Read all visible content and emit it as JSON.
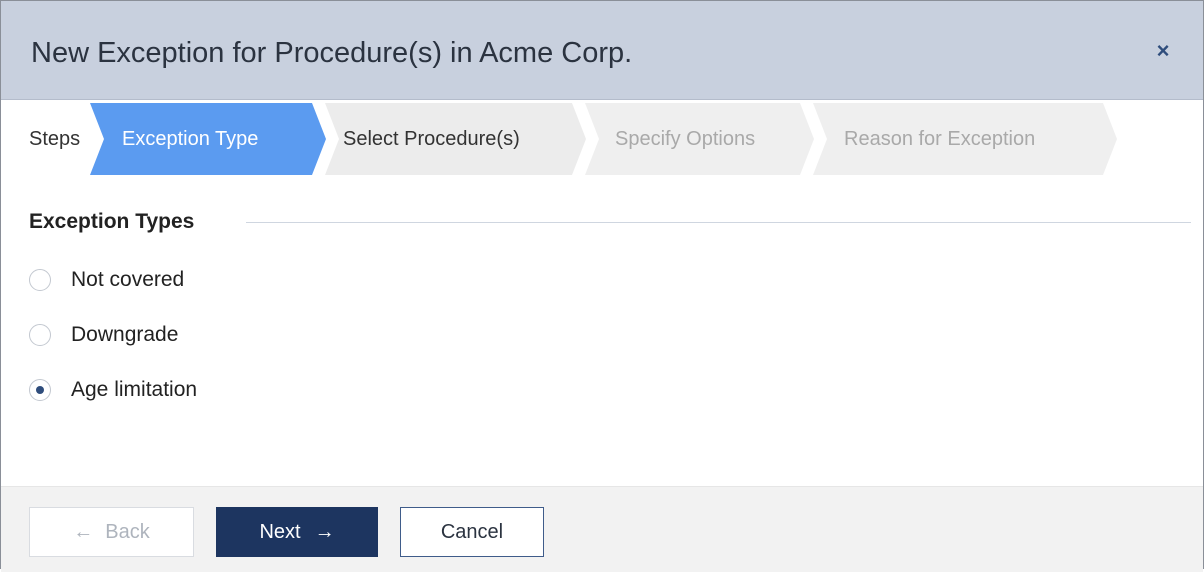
{
  "dialog": {
    "title": "New Exception for Procedure(s) in Acme Corp.",
    "close_icon": "×"
  },
  "steps": {
    "label": "Steps",
    "items": [
      {
        "label": "Exception Type",
        "state": "active"
      },
      {
        "label": "Select Procedure(s)",
        "state": "enabled"
      },
      {
        "label": "Specify Options",
        "state": "disabled"
      },
      {
        "label": "Reason for Exception",
        "state": "disabled"
      }
    ]
  },
  "exception_types": {
    "title": "Exception Types",
    "options": [
      {
        "label": "Not covered",
        "checked": false
      },
      {
        "label": "Downgrade",
        "checked": false
      },
      {
        "label": "Age limitation",
        "checked": true
      }
    ]
  },
  "footer": {
    "back_label": "Back",
    "back_icon": "←",
    "next_label": "Next",
    "next_icon": "→",
    "cancel_label": "Cancel"
  },
  "colors": {
    "header_bg": "#c8d0de",
    "active_step": "#5b9bf0",
    "primary_button": "#1d3560",
    "close_icon": "#2f4d7c"
  }
}
